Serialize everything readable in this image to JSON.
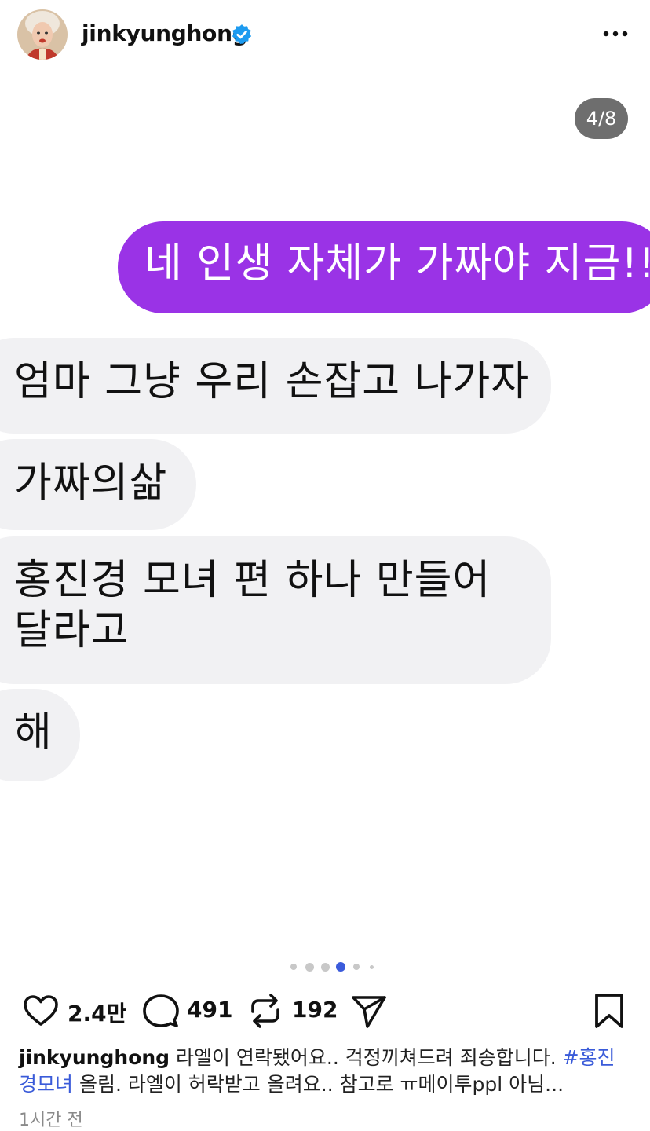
{
  "header": {
    "username": "jinkyunghong",
    "verified_icon": "verified-badge-icon",
    "more_icon": "more-horizontal-icon",
    "verified_color": "#1d9bf0"
  },
  "post": {
    "counter": "4/8",
    "messages": [
      {
        "side": "sent",
        "text": "네 인생 자체가 가짜야 지금!!"
      },
      {
        "side": "received",
        "text": "엄마 그냥 우리 손잡고 나가자"
      },
      {
        "side": "received",
        "text": "가짜의삶"
      },
      {
        "side": "received",
        "text": "홍진경 모녀 편 하나 만들어달라고"
      },
      {
        "side": "received",
        "text": "해"
      }
    ],
    "sent_bubble_color": "#9a33e6",
    "received_bubble_color": "#f1f1f3"
  },
  "carousel": {
    "total_dots": 6,
    "active_index": 3,
    "active_color": "#3b5bdb"
  },
  "actions": {
    "likes": "2.4만",
    "comments": "491",
    "reposts": "192",
    "icons": [
      "heart-icon",
      "comment-icon",
      "repost-icon",
      "share-icon",
      "bookmark-icon"
    ]
  },
  "caption": {
    "username": "jinkyunghong",
    "text_before": " 라엘이 연락됐어요.. 걱정끼쳐드려 죄송합니다. ",
    "hashtag": "#홍진경모녀",
    "text_after": " 올림. 라엘이 허락받고 올려요.. 참고로 ㅠ메이투ppl 아님..."
  },
  "timestamp": "1시간 전"
}
